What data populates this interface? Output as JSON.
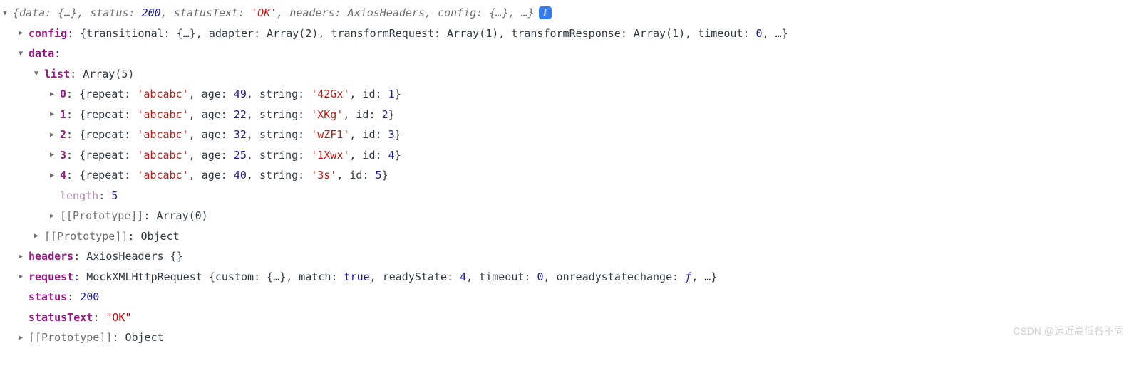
{
  "summary": {
    "parts": [
      {
        "t": "{",
        "c": "ital"
      },
      {
        "t": "data:",
        "c": "ital"
      },
      {
        "t": " ",
        "c": "ital"
      },
      {
        "t": "{…}",
        "c": "ital"
      },
      {
        "t": ", ",
        "c": "ital"
      },
      {
        "t": "status:",
        "c": "ital"
      },
      {
        "t": " ",
        "c": "ital"
      },
      {
        "t": "200",
        "c": "num ital"
      },
      {
        "t": ", ",
        "c": "ital"
      },
      {
        "t": "statusText:",
        "c": "ital"
      },
      {
        "t": " ",
        "c": "ital"
      },
      {
        "t": "'OK'",
        "c": "str ital"
      },
      {
        "t": ", ",
        "c": "ital"
      },
      {
        "t": "headers:",
        "c": "ital"
      },
      {
        "t": " ",
        "c": "ital"
      },
      {
        "t": "AxiosHeaders",
        "c": "ital"
      },
      {
        "t": ", ",
        "c": "ital"
      },
      {
        "t": "config:",
        "c": "ital"
      },
      {
        "t": " ",
        "c": "ital"
      },
      {
        "t": "{…}",
        "c": "ital"
      },
      {
        "t": ", …}",
        "c": "ital"
      }
    ]
  },
  "config": {
    "key": "config",
    "parts": [
      {
        "t": "{transitional: {…}, adapter: Array(2), transformRequest: Array(1), transformResponse: Array(1), timeout: ",
        "c": "darktext"
      },
      {
        "t": "0",
        "c": "num"
      },
      {
        "t": ", …}",
        "c": "darktext"
      }
    ]
  },
  "data": {
    "key": "data",
    "colon": ":",
    "list": {
      "key": "list",
      "preview": "Array(5)",
      "items": [
        {
          "idx": "0",
          "repeat": "'abcabc'",
          "age": "49",
          "string": "'42Gx'",
          "id": "1"
        },
        {
          "idx": "1",
          "repeat": "'abcabc'",
          "age": "22",
          "string": "'XKg'",
          "id": "2"
        },
        {
          "idx": "2",
          "repeat": "'abcabc'",
          "age": "32",
          "string": "'wZF1'",
          "id": "3"
        },
        {
          "idx": "3",
          "repeat": "'abcabc'",
          "age": "25",
          "string": "'1Xwx'",
          "id": "4"
        },
        {
          "idx": "4",
          "repeat": "'abcabc'",
          "age": "40",
          "string": "'3s'",
          "id": "5"
        }
      ],
      "lengthKey": "length",
      "length": "5",
      "protoKey": "[[Prototype]]",
      "protoVal": "Array(0)"
    },
    "protoKey": "[[Prototype]]",
    "protoVal": "Object"
  },
  "headers": {
    "key": "headers",
    "val": "AxiosHeaders {}"
  },
  "request": {
    "key": "request",
    "parts": [
      {
        "t": "MockXMLHttpRequest {custom: {…}, match: ",
        "c": "darktext"
      },
      {
        "t": "true",
        "c": "bool"
      },
      {
        "t": ", readyState: ",
        "c": "darktext"
      },
      {
        "t": "4",
        "c": "num"
      },
      {
        "t": ", timeout: ",
        "c": "darktext"
      },
      {
        "t": "0",
        "c": "num"
      },
      {
        "t": ", onreadystatechange: ",
        "c": "darktext"
      },
      {
        "t": "ƒ",
        "c": "kw"
      },
      {
        "t": ", …}",
        "c": "darktext"
      }
    ]
  },
  "status": {
    "key": "status",
    "val": "200"
  },
  "statusText": {
    "key": "statusText",
    "val": "\"OK\""
  },
  "proto": {
    "key": "[[Prototype]]",
    "val": "Object"
  },
  "watermark": "CSDN @远近高低各不同"
}
